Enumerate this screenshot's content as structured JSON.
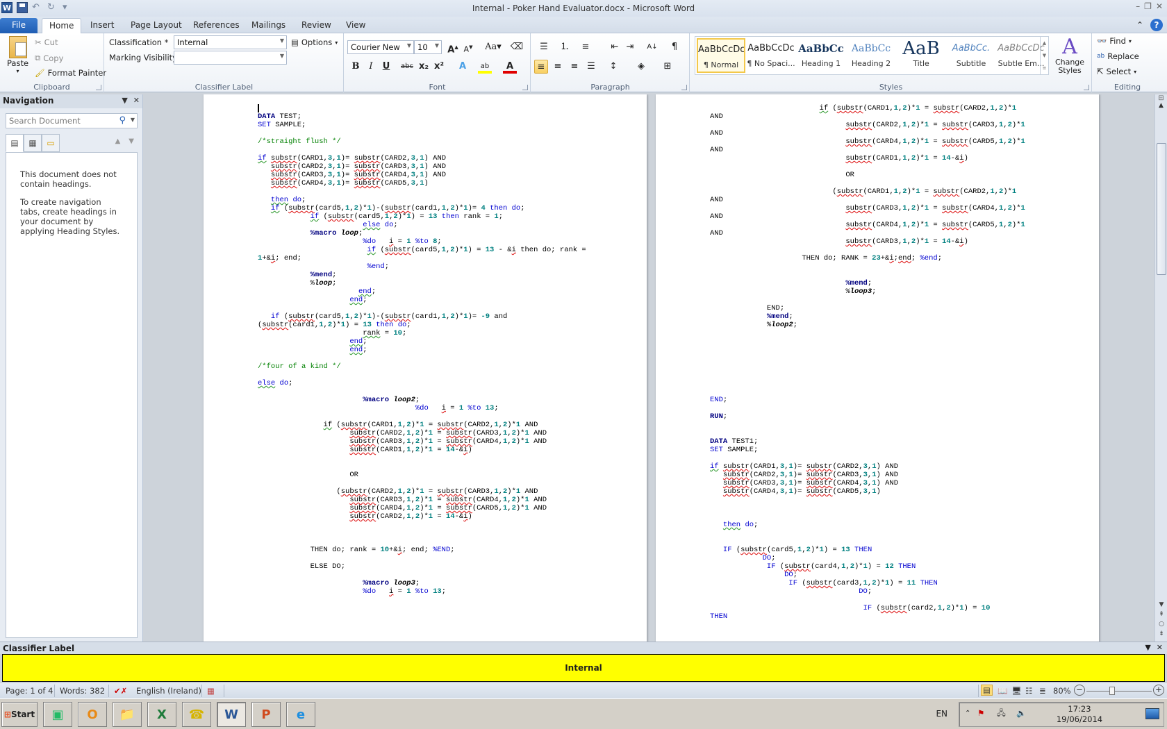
{
  "window": {
    "title": "Internal - Poker Hand Evaluator.docx - Microsoft Word",
    "controls": {
      "minimize": "–",
      "restore": "❐",
      "close": "✕"
    }
  },
  "quick_access": {
    "app_icon": "W",
    "save": "save-icon",
    "undo": "↶",
    "redo": "↻"
  },
  "tabs": [
    {
      "label": "File"
    },
    {
      "label": "Home"
    },
    {
      "label": "Insert"
    },
    {
      "label": "Page Layout"
    },
    {
      "label": "References"
    },
    {
      "label": "Mailings"
    },
    {
      "label": "Review"
    },
    {
      "label": "View"
    }
  ],
  "ribbon": {
    "clipboard": {
      "label": "Clipboard",
      "paste": "Paste",
      "cut": "Cut",
      "copy": "Copy",
      "format_painter": "Format Painter"
    },
    "classifier": {
      "label": "Classifier Label",
      "classification_label": "Classification *",
      "classification_value": "Internal",
      "marking_label": "Marking Visibility",
      "marking_value": "",
      "options": "Options"
    },
    "font": {
      "label": "Font",
      "font_name": "Courier New",
      "font_size": "10"
    },
    "paragraph": {
      "label": "Paragraph"
    },
    "styles": {
      "label": "Styles",
      "items": [
        {
          "preview": "AaBbCcDc",
          "name": "¶ Normal"
        },
        {
          "preview": "AaBbCcDc",
          "name": "¶ No Spaci..."
        },
        {
          "preview": "AaBbCc",
          "name": "Heading 1"
        },
        {
          "preview": "AaBbCc",
          "name": "Heading 2"
        },
        {
          "preview": "AaB",
          "name": "Title"
        },
        {
          "preview": "AaBbCc.",
          "name": "Subtitle"
        },
        {
          "preview": "AaBbCcDc",
          "name": "Subtle Em..."
        }
      ],
      "change_styles": "Change Styles"
    },
    "editing": {
      "label": "Editing",
      "find": "Find",
      "replace": "Replace",
      "select": "Select"
    }
  },
  "navigation": {
    "title": "Navigation",
    "search_placeholder": "Search Document",
    "message1": "This document does not contain headings.",
    "message2": "To create navigation tabs, create headings in your document by applying Heading Styles."
  },
  "classifier_panel": {
    "title": "Classifier Label",
    "value": "Internal",
    "color": "#ffff00"
  },
  "status": {
    "page": "Page: 1 of 4",
    "words": "Words: 382",
    "language": "English (Ireland)",
    "zoom": "80%",
    "zoom_level_percent": 80
  },
  "taskbar": {
    "start": "Start",
    "lang": "EN",
    "time": "17:23",
    "date": "19/06/2014"
  }
}
